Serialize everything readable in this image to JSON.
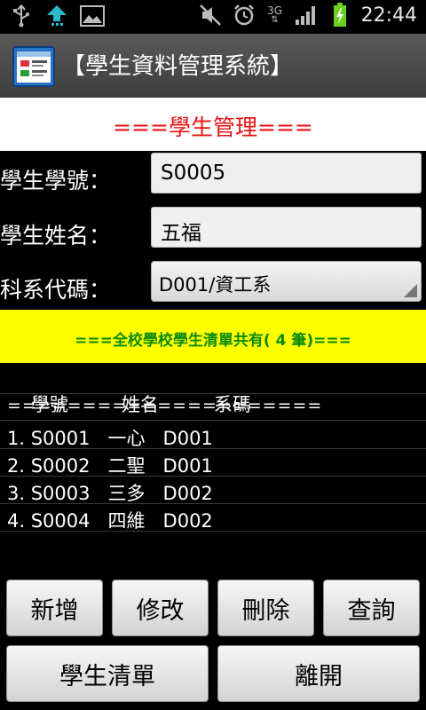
{
  "status_bar": {
    "time": "22:44",
    "network": "3G",
    "icons": [
      "usb-icon",
      "upload-icon",
      "image-icon",
      "mute-icon",
      "alarm-icon",
      "signal-icon",
      "battery-charging-icon"
    ]
  },
  "app": {
    "title": "【學生資料管理系統】"
  },
  "section": {
    "title": "===學生管理==="
  },
  "form": {
    "student_id": {
      "label": "學生學號：",
      "value": "S0005"
    },
    "student_name": {
      "label": "學生姓名：",
      "value": "五福"
    },
    "department": {
      "label": "科系代碼：",
      "value": "D001/資工系"
    }
  },
  "summary": {
    "text": "===全校學校學生清單共有(",
    "count": "4",
    "suffix": "筆)==="
  },
  "list": {
    "header": {
      "col1": "學號",
      "col2": "姓名",
      "col3": "系碼"
    },
    "separator": "=====================",
    "rows": [
      "1. S0001   一心   D001",
      "2. S0002   二聖   D001",
      "3. S0003   三多   D002",
      "4. S0004   四維   D002"
    ]
  },
  "buttons": {
    "add": "新增",
    "edit": "修改",
    "delete": "刪除",
    "query": "查詢",
    "list": "學生清單",
    "exit": "離開"
  },
  "colors": {
    "section_title": "#e81212",
    "summary_bg": "#ffff00",
    "summary_text": "#0b8a0b",
    "charging": "#6ccf1e"
  }
}
